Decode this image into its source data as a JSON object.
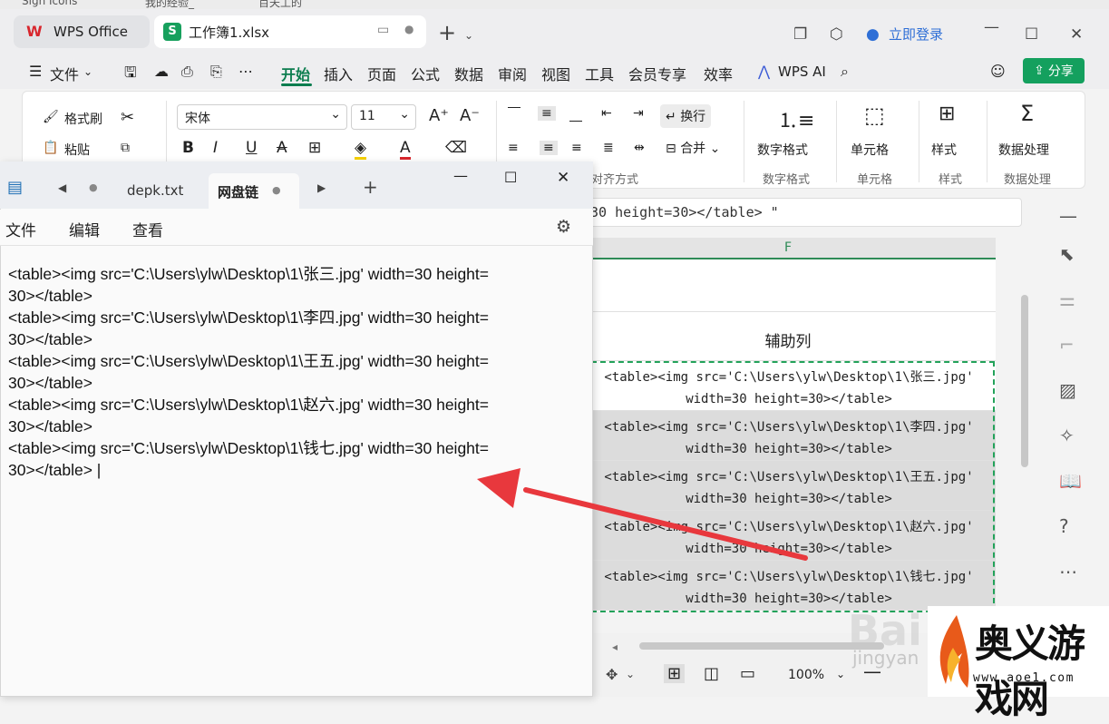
{
  "bookmarks": [
    "Sign Icons",
    "我的经验_",
    "百夫丄的"
  ],
  "wps": {
    "app_tab": "WPS Office",
    "doc_tab": "工作簿1.xlsx",
    "login": "立即登录",
    "menu": [
      "文件",
      "开始",
      "插入",
      "页面",
      "公式",
      "数据",
      "审阅",
      "视图",
      "工具",
      "会员专享",
      "效率"
    ],
    "wps_ai": "WPS AI",
    "share": "分享",
    "ribbon": {
      "format_painter": "格式刷",
      "paste": "粘贴",
      "font_name": "宋体",
      "font_size": "11",
      "wrap": "换行",
      "merge": "合并",
      "align_group": "对齐方式",
      "number_format": "数字格式",
      "number_format_group": "数字格式",
      "cell": "单元格",
      "cell_group": "单元格",
      "style": "样式",
      "style_group": "样式",
      "data_process": "数据处理",
      "data_process_group": "数据处理"
    },
    "formula_text": "30 height=30></table> \"",
    "column_header": "F",
    "header_cell": "辅助列",
    "rows": [
      {
        "line1": "<table><img src='C:\\Users\\ylw\\Desktop\\1\\张三.jpg'",
        "line2": "width=30 height=30></table>"
      },
      {
        "line1": "<table><img src='C:\\Users\\ylw\\Desktop\\1\\李四.jpg'",
        "line2": "width=30 height=30></table>"
      },
      {
        "line1": "<table><img src='C:\\Users\\ylw\\Desktop\\1\\王五.jpg'",
        "line2": "width=30 height=30></table>"
      },
      {
        "line1": "<table><img src='C:\\Users\\ylw\\Desktop\\1\\赵六.jpg'",
        "line2": "width=30 height=30></table>"
      },
      {
        "line1": "<table><img src='C:\\Users\\ylw\\Desktop\\1\\钱七.jpg'",
        "line2": "width=30 height=30></table>"
      }
    ],
    "zoom": "100%"
  },
  "notepad": {
    "tab_inactive": "depk.txt",
    "tab_active": "网盘链",
    "menu": [
      "文件",
      "编辑",
      "查看"
    ],
    "content": "<table><img src='C:\\Users\\ylw\\Desktop\\1\\张三.jpg' width=30 height=\n30></table>\n<table><img src='C:\\Users\\ylw\\Desktop\\1\\李四.jpg' width=30 height=\n30></table>\n<table><img src='C:\\Users\\ylw\\Desktop\\1\\王五.jpg' width=30 height=\n30></table>\n<table><img src='C:\\Users\\ylw\\Desktop\\1\\赵六.jpg' width=30 height=\n30></table>\n<table><img src='C:\\Users\\ylw\\Desktop\\1\\钱七.jpg' width=30 height=\n30></table> |"
  },
  "watermark": {
    "baidu": "Bai",
    "jingyan": "jingyan",
    "site_name": "奥义游戏网",
    "site_url": "www.aoe1.com"
  },
  "colors": {
    "accent": "#0c7d4f",
    "share_bg": "#14a05e",
    "arrow": "#e8383d",
    "selection": "#23a25a"
  }
}
